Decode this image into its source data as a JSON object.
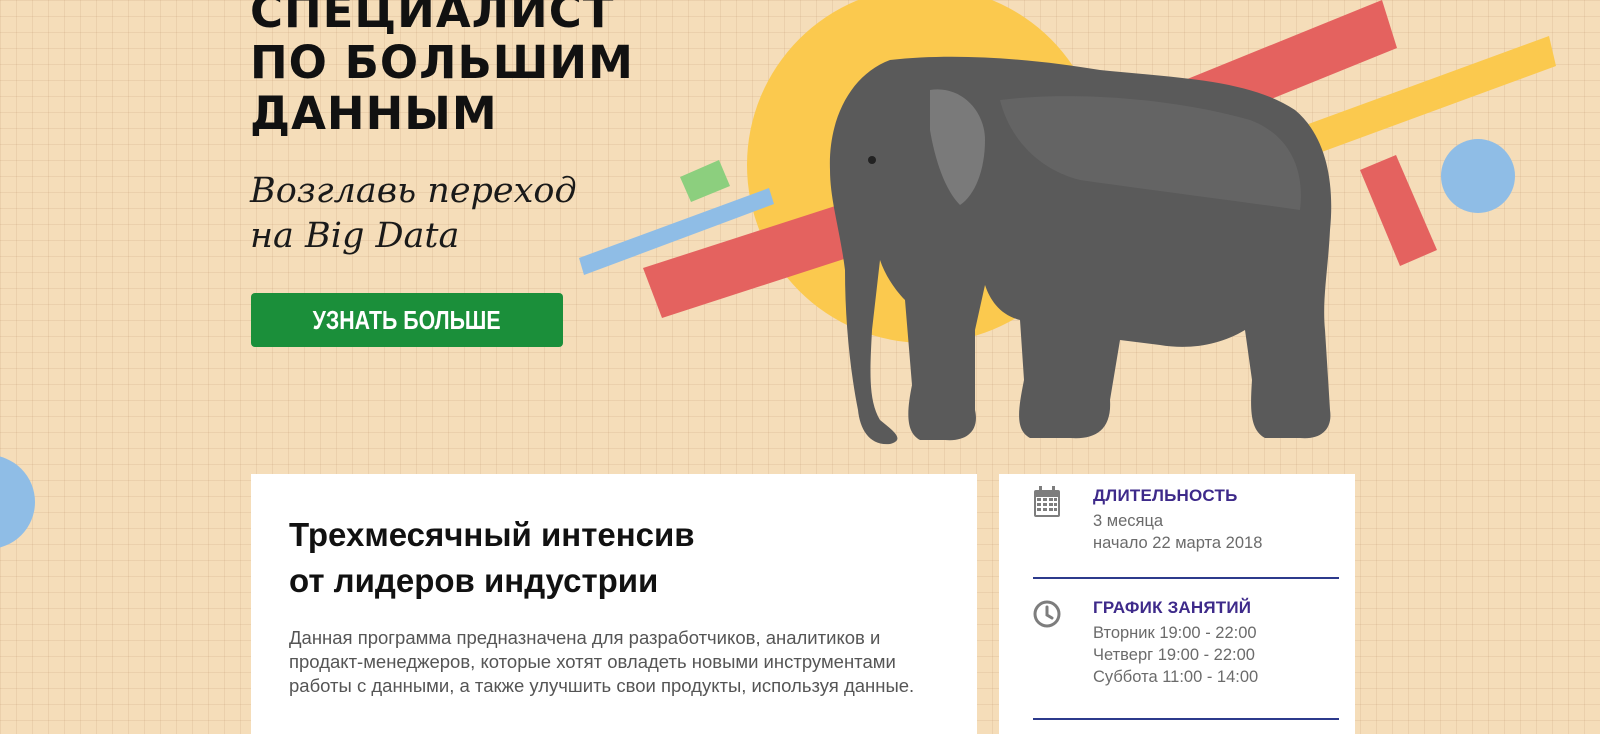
{
  "hero": {
    "title_lines": [
      "СПЕЦИАЛИСТ",
      "ПО БОЛЬШИМ",
      "ДАННЫМ"
    ],
    "subtitle_lines": [
      "Возглавь переход",
      "на Big Data"
    ],
    "cta_label": "УЗНАТЬ БОЛЬШЕ"
  },
  "main_card": {
    "heading_lines": [
      "Трехмесячный интенсив",
      "от лидеров индустрии"
    ],
    "description": "Данная программа предназначена для разработчиков, аналитиков и продакт-менеджеров, которые хотят овладеть новыми инструментами работы с данными, а также улучшить свои продукты, используя данные."
  },
  "info_card": {
    "duration": {
      "icon": "calendar-icon",
      "title": "ДЛИТЕЛЬНОСТЬ",
      "lines": [
        "3 месяца",
        "начало 22 марта 2018"
      ]
    },
    "schedule": {
      "icon": "clock-icon",
      "title": "ГРАФИК ЗАНЯТИЙ",
      "lines": [
        "Вторник 19:00 - 22:00",
        "Четверг 19:00 - 22:00",
        "Суббота 11:00 - 14:00"
      ]
    }
  },
  "colors": {
    "background": "#f5ddb9",
    "cta": "#1b8f3a",
    "accent_red": "#e4625f",
    "accent_yellow": "#fbc94e",
    "accent_blue": "#8fbde6",
    "accent_green": "#8ccf7e",
    "info_title": "#3e2a8a",
    "divider": "#2c3a8c"
  }
}
